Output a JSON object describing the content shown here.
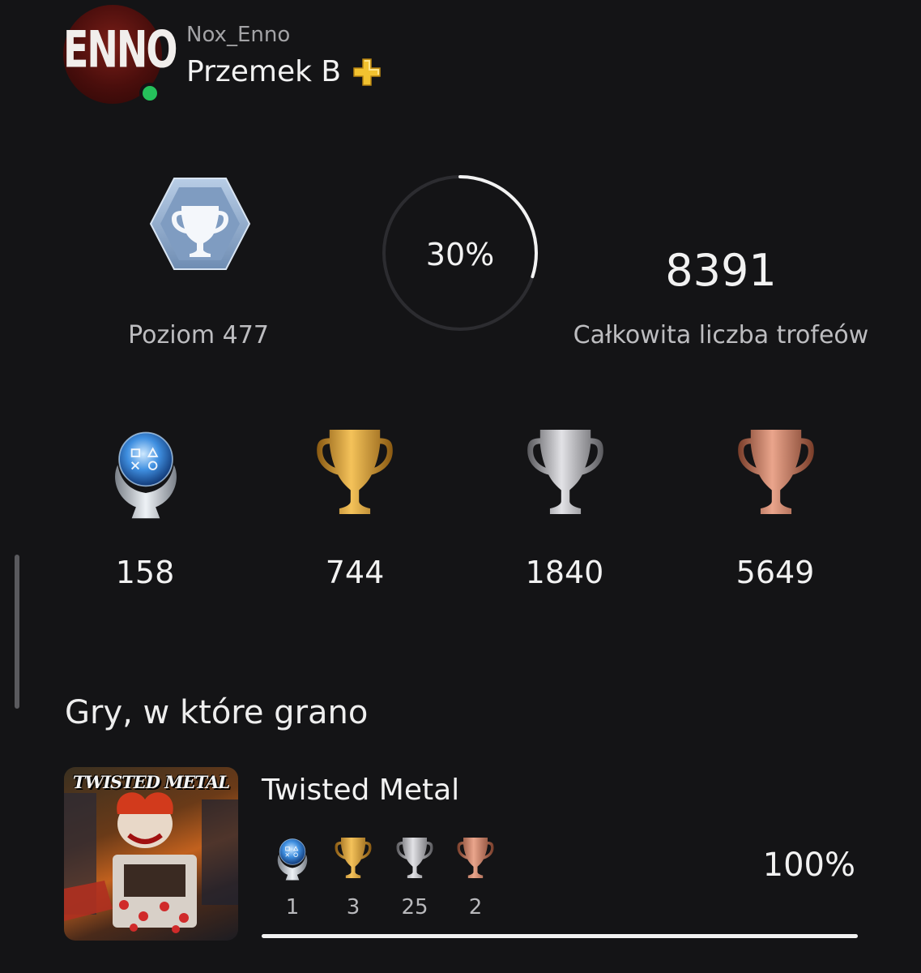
{
  "profile": {
    "avatar_text": "ENNO",
    "online_id": "Nox_Enno",
    "real_name": "Przemek B",
    "ps_plus_icon": "ps-plus-icon",
    "online_status_color": "#25c15b"
  },
  "stats": {
    "level_label": "Poziom 477",
    "progress_text": "30%",
    "progress_fraction": 0.3,
    "total_trophies": "8391",
    "total_label": "Całkowita liczba trofeów"
  },
  "trophies": {
    "platinum": "158",
    "gold": "744",
    "silver": "1840",
    "bronze": "5649"
  },
  "section_title": "Gry, w które grano",
  "games": [
    {
      "cover_text": "TWISTED METAL",
      "title": "Twisted Metal",
      "platinum": "1",
      "gold": "3",
      "silver": "25",
      "bronze": "2",
      "progress_text": "100%",
      "progress_fraction": 1.0
    }
  ],
  "colors": {
    "platinum": "#5da8e8",
    "gold": "#e0a63a",
    "silver": "#b8b8bc",
    "bronze": "#c98068"
  }
}
